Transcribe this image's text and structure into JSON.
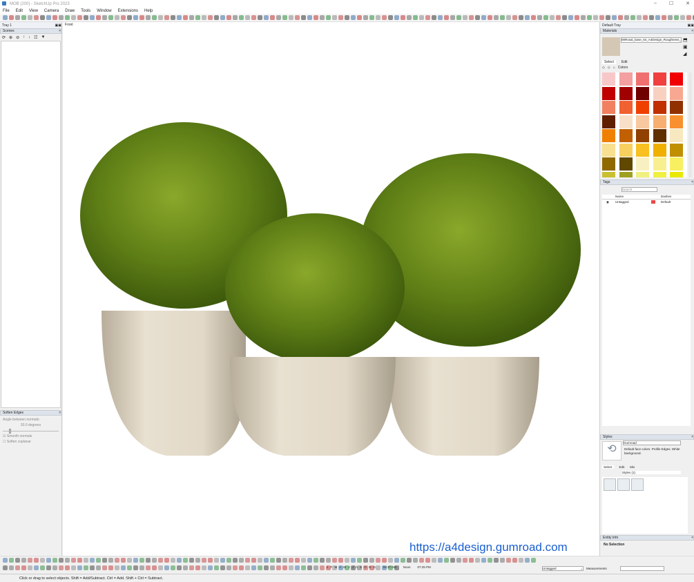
{
  "window": {
    "title": "MOB (200) - SketchUp Pro 2023",
    "min": "–",
    "max": "☐",
    "close": "✕"
  },
  "menu": [
    "File",
    "Edit",
    "View",
    "Camera",
    "Draw",
    "Tools",
    "Window",
    "Extensions",
    "Help"
  ],
  "left_tray": {
    "title": "Tray 1",
    "scenes": {
      "title": "Scenes"
    },
    "soften": {
      "title": "Soften Edges",
      "angle_label": "Angle between normals:",
      "angle_value": "20.0  degrees",
      "angle_fraction": 0.11,
      "smooth_normals": "Smooth normals",
      "soften_coplanar": "Soften coplanar",
      "smooth_checked": true,
      "coplanar_checked": false
    }
  },
  "viewport": {
    "scene_tab": "Front",
    "watermark": "https://a4design.gumroad.com"
  },
  "right_tray": {
    "title": "Default Tray",
    "materials": {
      "title": "Materials",
      "name": "00Rosal_base_64_A4Design_Roughness_83",
      "tab_select": "Select",
      "tab_edit": "Edit",
      "library": "Colors",
      "swatches": [
        "#f8c8c8",
        "#f4a0a0",
        "#f07070",
        "#f04040",
        "#f00000",
        "#c00000",
        "#a00000",
        "#700000",
        "#f8d0c0",
        "#f8a890",
        "#f08060",
        "#f06030",
        "#f04000",
        "#c03000",
        "#903000",
        "#602000",
        "#f8e0c8",
        "#f8c8a0",
        "#f8b070",
        "#f89030",
        "#f08000",
        "#c06000",
        "#904000",
        "#603000",
        "#f8e8c0",
        "#f8e090",
        "#f8d060",
        "#f8c020",
        "#f0b000",
        "#c09000",
        "#906800",
        "#604800",
        "#f8f0c0",
        "#f8f090",
        "#f8f060",
        "#c8c030",
        "#a0a020",
        "#f0f080",
        "#f0f040",
        "#e8e800"
      ]
    },
    "tags": {
      "title": "Tags",
      "search_placeholder": "Search",
      "col_name": "Name",
      "col_dashes": "Dashes",
      "rows": [
        {
          "name": "Untagged",
          "color": "#e84848",
          "dashes": "Default"
        }
      ]
    },
    "styles": {
      "title": "Styles",
      "name": "Gumroad",
      "description": "Default face colors. Profile Edges. White background.",
      "tab_select": "Select",
      "tab_edit": "Edit",
      "tab_mix": "Mix",
      "collection": "Styles (1)"
    },
    "entity_info": {
      "title": "Entity Info",
      "value": "No Selection"
    }
  },
  "bottom": {
    "months": "J F M A M J J A S O N D",
    "time_start": "04:37 AM",
    "time_noon": "Noon",
    "time_end": "07:25 PM",
    "tag_select": "Untagged",
    "measurements_label": "Measurements"
  },
  "status": {
    "text": "Click or drag to select objects. Shift = Add/Subtract. Ctrl = Add. Shift + Ctrl = Subtract."
  }
}
